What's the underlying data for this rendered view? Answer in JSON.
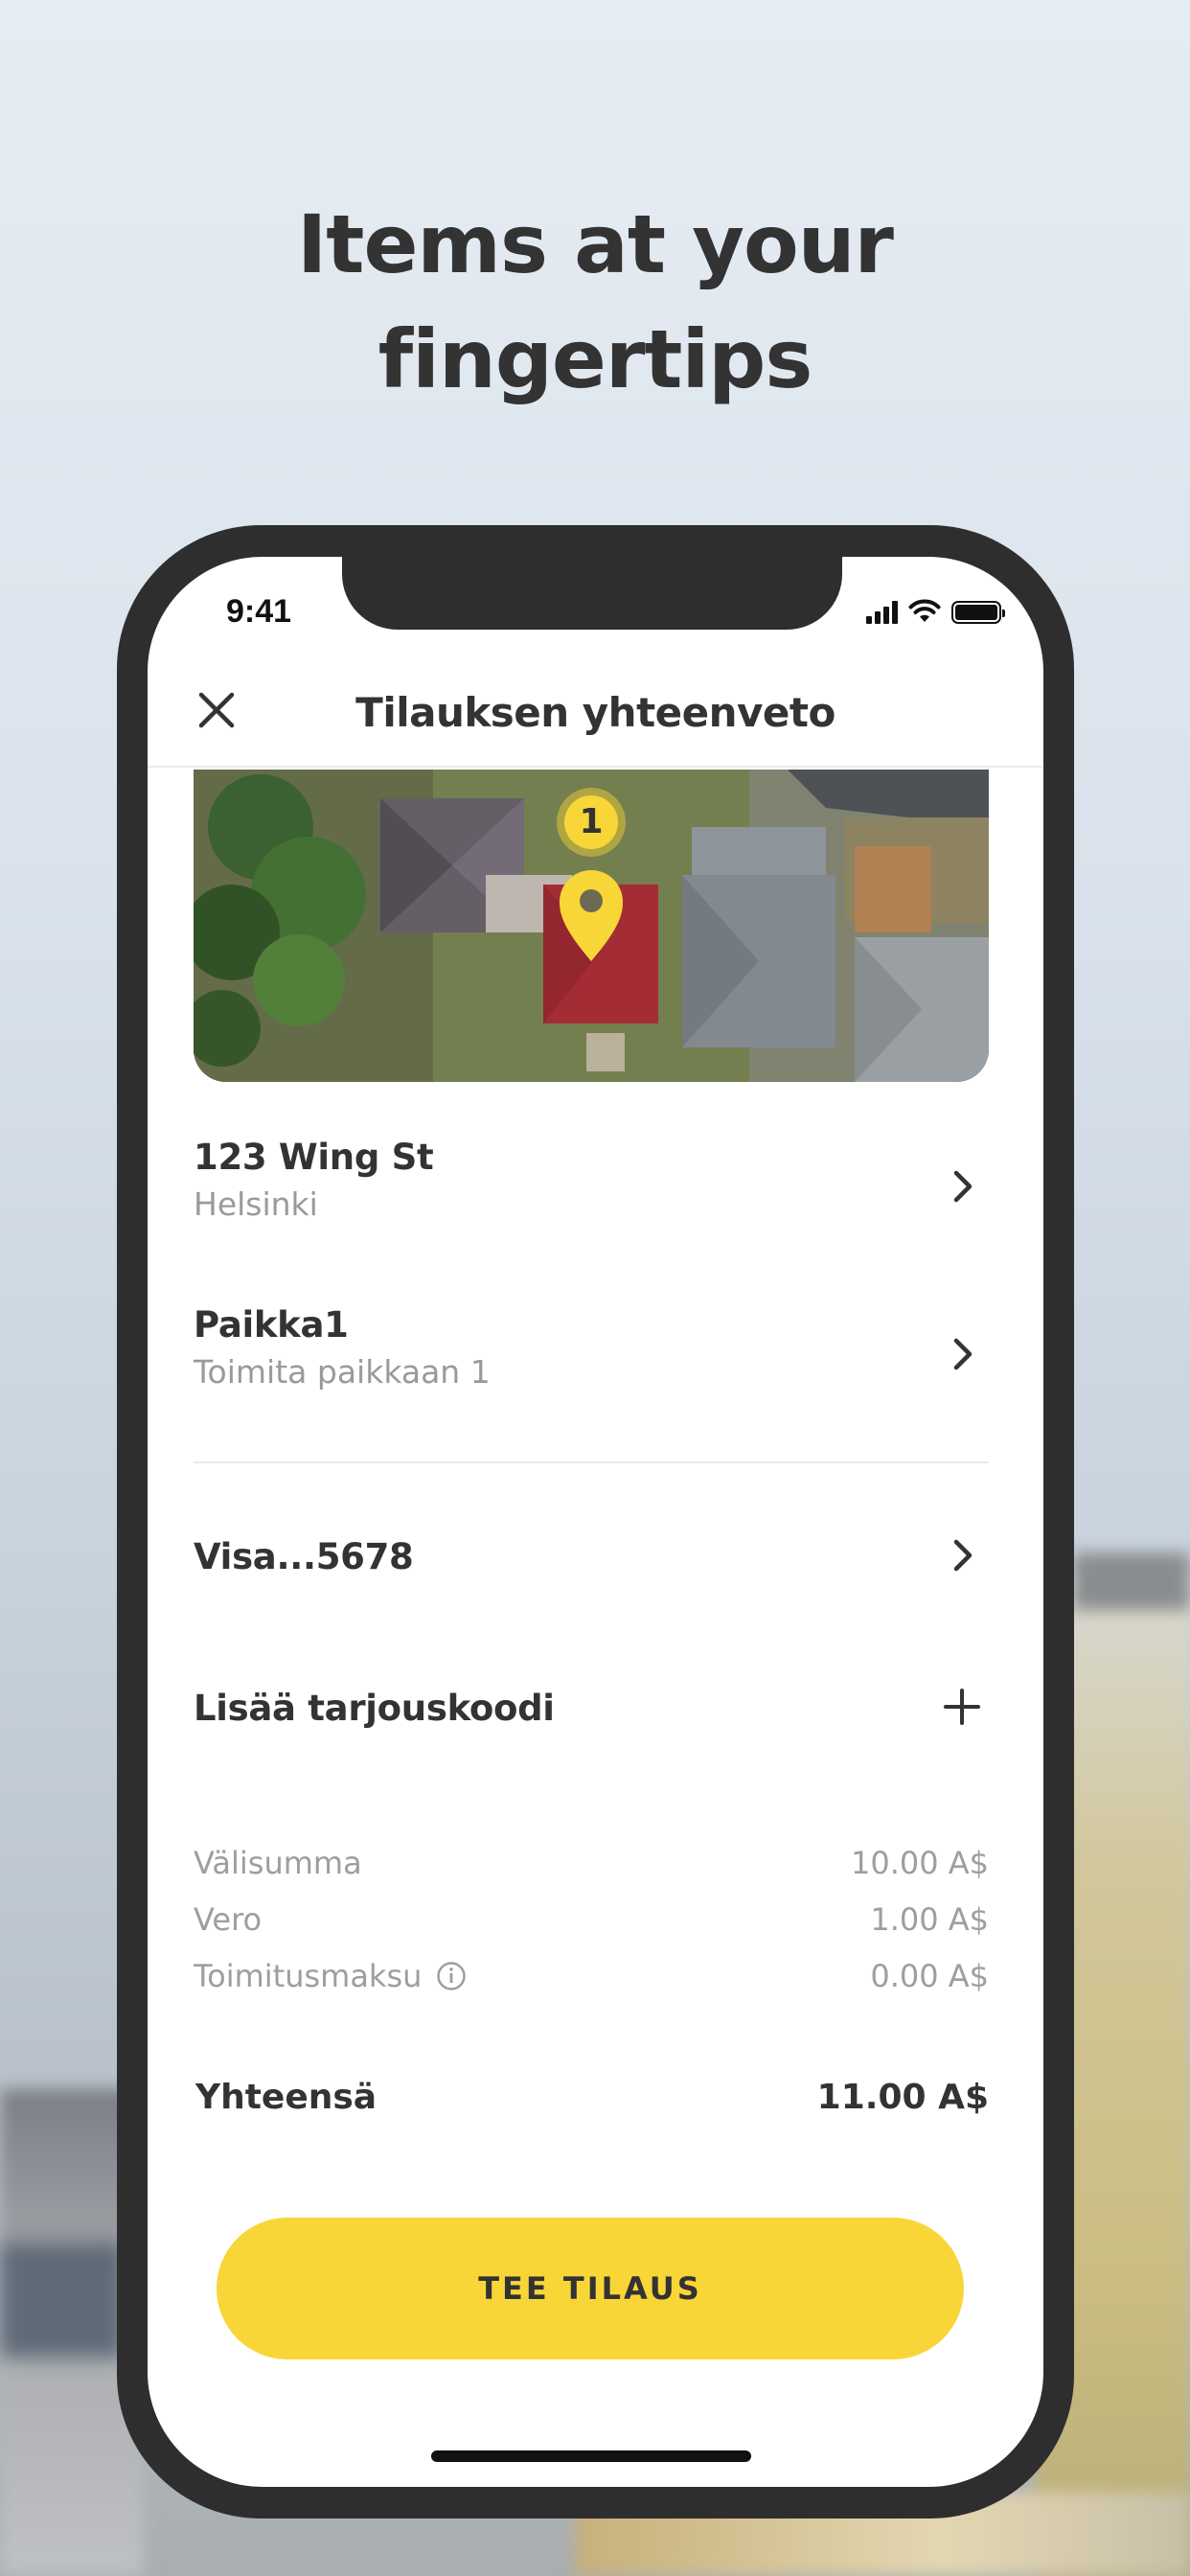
{
  "headline": {
    "line1": "Items at your",
    "line2": "fingertips"
  },
  "status_bar": {
    "time": "9:41"
  },
  "nav": {
    "title": "Tilauksen yhteenveto",
    "close_icon": "close-icon"
  },
  "map": {
    "marker_label": "1",
    "pin_color": "#f9d637"
  },
  "address": {
    "title": "123 Wing St",
    "subtitle": "Helsinki"
  },
  "location": {
    "title": "Paikka1",
    "subtitle": "Toimita paikkaan 1"
  },
  "payment": {
    "title": "Visa...5678"
  },
  "promo": {
    "title": "Lisää tarjouskoodi"
  },
  "summary": {
    "subtotal_label": "Välisumma",
    "subtotal_value": "10.00 A$",
    "tax_label": "Vero",
    "tax_value": "1.00 A$",
    "delivery_label": "Toimitusmaksu",
    "delivery_value": "0.00 A$",
    "total_label": "Yhteensä",
    "total_value": "11.00 A$"
  },
  "order_button": {
    "label": "TEE TILAUS"
  },
  "colors": {
    "accent": "#f9d637",
    "text": "#333333",
    "muted": "#9e9e9e",
    "phone_frame": "#2e2e2e"
  }
}
